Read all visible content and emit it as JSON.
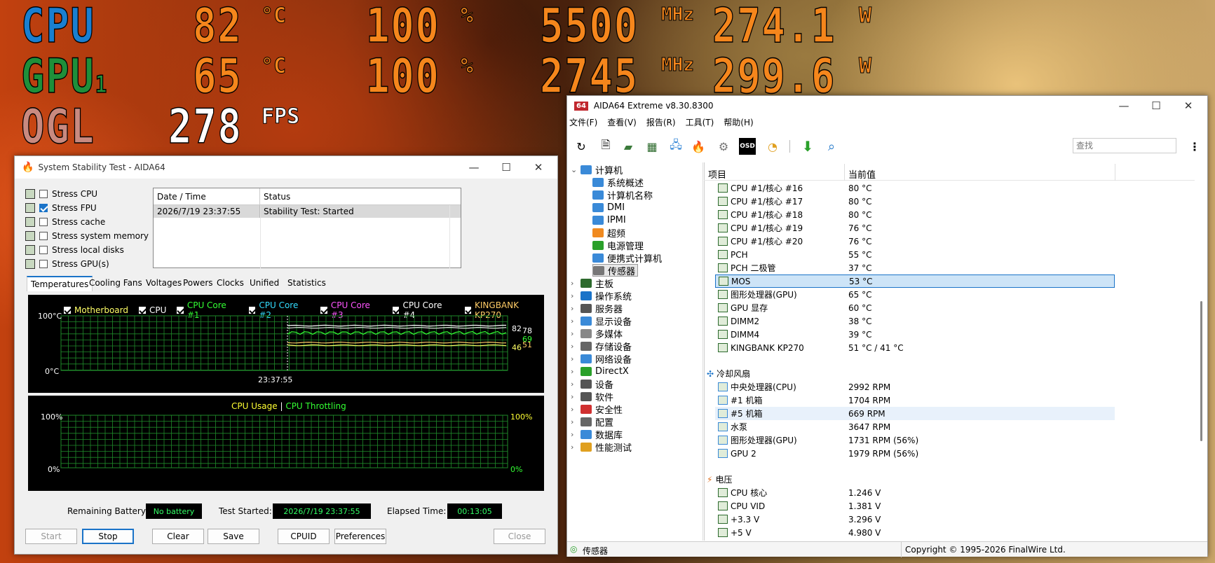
{
  "osd": {
    "cpu": {
      "label": "CPU",
      "temp": "82",
      "temp_unit": "°C",
      "load": "100",
      "load_unit": "%",
      "clock": "5500",
      "clock_unit": "MHz",
      "power": "274.1",
      "power_unit": "W"
    },
    "gpu": {
      "label": "GPU",
      "label_sub": "1",
      "temp": "65",
      "temp_unit": "°C",
      "load": "100",
      "load_unit": "%",
      "clock": "2745",
      "clock_unit": "MHz",
      "power": "299.6",
      "power_unit": "W"
    },
    "ogl": {
      "label": "OGL",
      "fps": "278",
      "fps_unit": "FPS"
    },
    "colors": {
      "cpu": "#1a7fd0",
      "gpu": "#1f8f3a",
      "ogl": "#c98a80",
      "values": "#f5861c"
    }
  },
  "sst": {
    "title": "System Stability Test - AIDA64",
    "stress": [
      {
        "label": "Stress CPU",
        "checked": false
      },
      {
        "label": "Stress FPU",
        "checked": true
      },
      {
        "label": "Stress cache",
        "checked": false
      },
      {
        "label": "Stress system memory",
        "checked": false
      },
      {
        "label": "Stress local disks",
        "checked": false
      },
      {
        "label": "Stress GPU(s)",
        "checked": false
      }
    ],
    "log_headers": [
      "Date / Time",
      "Status"
    ],
    "log_rows": [
      {
        "time": "2026/7/19 23:37:55",
        "status": "Stability Test: Started"
      }
    ],
    "tabs": [
      "Temperatures",
      "Cooling Fans",
      "Voltages",
      "Powers",
      "Clocks",
      "Unified",
      "Statistics"
    ],
    "temp_legend": [
      {
        "label": "Motherboard",
        "color": "#ffff66"
      },
      {
        "label": "CPU",
        "color": "#ffffff"
      },
      {
        "label": "CPU Core #1",
        "color": "#33ff33"
      },
      {
        "label": "CPU Core #2",
        "color": "#33ddff"
      },
      {
        "label": "CPU Core #3",
        "color": "#ff55ff"
      },
      {
        "label": "CPU Core #4",
        "color": "#ffffff"
      },
      {
        "label": "KINGBANK KP270",
        "color": "#ffcc66"
      }
    ],
    "temp_axis": {
      "top": "100",
      "top_unit": "°C",
      "bottom": "0",
      "bottom_unit": "°C",
      "time": "23:37:55"
    },
    "temp_values": [
      "82",
      "78",
      "69",
      "51",
      "46"
    ],
    "usage_legend": {
      "usage": "CPU Usage",
      "sep": "|",
      "throttle": "CPU Throttling"
    },
    "usage_axis": {
      "top_left": "100%",
      "bottom_left": "0%",
      "top_right": "100%",
      "bottom_right": "0%"
    },
    "status": {
      "battery_label": "Remaining Battery:",
      "battery_value": "No battery",
      "started_label": "Test Started:",
      "started_value": "2026/7/19 23:37:55",
      "elapsed_label": "Elapsed Time:",
      "elapsed_value": "00:13:05"
    },
    "buttons": {
      "start": "Start",
      "stop": "Stop",
      "clear": "Clear",
      "save": "Save",
      "cpuid": "CPUID",
      "preferences": "Preferences",
      "close": "Close"
    }
  },
  "aida": {
    "title": "AIDA64 Extreme v8.30.8300",
    "logo": "64",
    "menu": [
      "文件(F)",
      "查看(V)",
      "报告(R)",
      "工具(T)",
      "帮助(H)"
    ],
    "search_placeholder": "查找",
    "tree": [
      {
        "label": "计算机",
        "level": 0,
        "expander": "⌄",
        "icon_color": "#3a8ad8"
      },
      {
        "label": "系统概述",
        "level": 1,
        "icon_color": "#3a8ad8"
      },
      {
        "label": "计算机名称",
        "level": 1,
        "icon_color": "#3a8ad8"
      },
      {
        "label": "DMI",
        "level": 1,
        "icon_color": "#3a8ad8"
      },
      {
        "label": "IPMI",
        "level": 1,
        "icon_color": "#3a8ad8"
      },
      {
        "label": "超频",
        "level": 1,
        "icon_color": "#f08a20"
      },
      {
        "label": "电源管理",
        "level": 1,
        "icon_color": "#2aa02a"
      },
      {
        "label": "便携式计算机",
        "level": 1,
        "icon_color": "#3a8ad8"
      },
      {
        "label": "传感器",
        "level": 1,
        "icon_color": "#777777",
        "selected": true
      },
      {
        "label": "主板",
        "level": 0,
        "expander": "›",
        "icon_color": "#2d6a2d"
      },
      {
        "label": "操作系统",
        "level": 0,
        "expander": "›",
        "icon_color": "#1a73c8"
      },
      {
        "label": "服务器",
        "level": 0,
        "expander": "›",
        "icon_color": "#555555"
      },
      {
        "label": "显示设备",
        "level": 0,
        "expander": "›",
        "icon_color": "#3a8ad8"
      },
      {
        "label": "多媒体",
        "level": 0,
        "expander": "›",
        "icon_color": "#888888"
      },
      {
        "label": "存储设备",
        "level": 0,
        "expander": "›",
        "icon_color": "#666666"
      },
      {
        "label": "网络设备",
        "level": 0,
        "expander": "›",
        "icon_color": "#3a8ad8"
      },
      {
        "label": "DirectX",
        "level": 0,
        "expander": "›",
        "icon_color": "#2aa02a"
      },
      {
        "label": "设备",
        "level": 0,
        "expander": "›",
        "icon_color": "#555555"
      },
      {
        "label": "软件",
        "level": 0,
        "expander": "›",
        "icon_color": "#555555"
      },
      {
        "label": "安全性",
        "level": 0,
        "expander": "›",
        "icon_color": "#d03030"
      },
      {
        "label": "配置",
        "level": 0,
        "expander": "›",
        "icon_color": "#666666"
      },
      {
        "label": "数据库",
        "level": 0,
        "expander": "›",
        "icon_color": "#3a8ad8"
      },
      {
        "label": "性能测试",
        "level": 0,
        "expander": "›",
        "icon_color": "#e0a020"
      }
    ],
    "columns": [
      "项目",
      "当前值"
    ],
    "rows": [
      {
        "item": "CPU #1/核心 #16",
        "value": "80 °C"
      },
      {
        "item": "CPU #1/核心 #17",
        "value": "80 °C"
      },
      {
        "item": "CPU #1/核心 #18",
        "value": "80 °C"
      },
      {
        "item": "CPU #1/核心 #19",
        "value": "76 °C"
      },
      {
        "item": "CPU #1/核心 #20",
        "value": "76 °C"
      },
      {
        "item": "PCH",
        "value": "55 °C"
      },
      {
        "item": "PCH 二极管",
        "value": "37 °C"
      },
      {
        "item": "MOS",
        "value": "53 °C",
        "selected": true
      },
      {
        "item": "图形处理器(GPU)",
        "value": "65 °C"
      },
      {
        "item": "GPU 显存",
        "value": "60 °C"
      },
      {
        "item": "DIMM2",
        "value": "38 °C"
      },
      {
        "item": "DIMM4",
        "value": "39 °C"
      },
      {
        "item": "KINGBANK KP270",
        "value": "51 °C / 41 °C"
      }
    ],
    "fan_section": "冷却风扇",
    "fan_rows": [
      {
        "item": "中央处理器(CPU)",
        "value": "2992 RPM"
      },
      {
        "item": "#1 机箱",
        "value": "1704 RPM"
      },
      {
        "item": "#5 机箱",
        "value": "669 RPM",
        "hover": true
      },
      {
        "item": "水泵",
        "value": "3647 RPM"
      },
      {
        "item": "图形处理器(GPU)",
        "value": "1731 RPM  (56%)"
      },
      {
        "item": "GPU 2",
        "value": "1979 RPM  (56%)"
      }
    ],
    "volt_section": "电压",
    "volt_rows": [
      {
        "item": "CPU 核心",
        "value": "1.246 V"
      },
      {
        "item": "CPU VID",
        "value": "1.381 V"
      },
      {
        "item": "+3.3 V",
        "value": "3.296 V"
      },
      {
        "item": "+5 V",
        "value": "4.980 V"
      }
    ],
    "statusbar": {
      "left": "传感器",
      "right": "Copyright © 1995-2026 FinalWire Ltd."
    }
  }
}
